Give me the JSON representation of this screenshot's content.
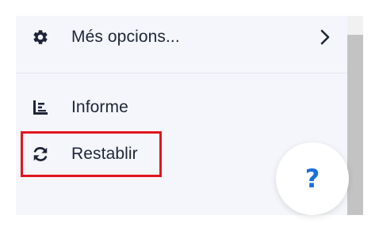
{
  "menu": {
    "more_options": {
      "label": "Més opcions...",
      "icon": "gear-icon"
    },
    "report": {
      "label": "Informe",
      "icon": "bar-chart-icon"
    },
    "reset": {
      "label": "Restablir",
      "icon": "refresh-icon"
    }
  },
  "help": {
    "label": "?"
  },
  "colors": {
    "panel_bg": "#f4f6fb",
    "text": "#1f2538",
    "highlight": "#e3141f",
    "accent": "#1a6fe0",
    "scrollbar_thumb": "#c3c3c3"
  }
}
